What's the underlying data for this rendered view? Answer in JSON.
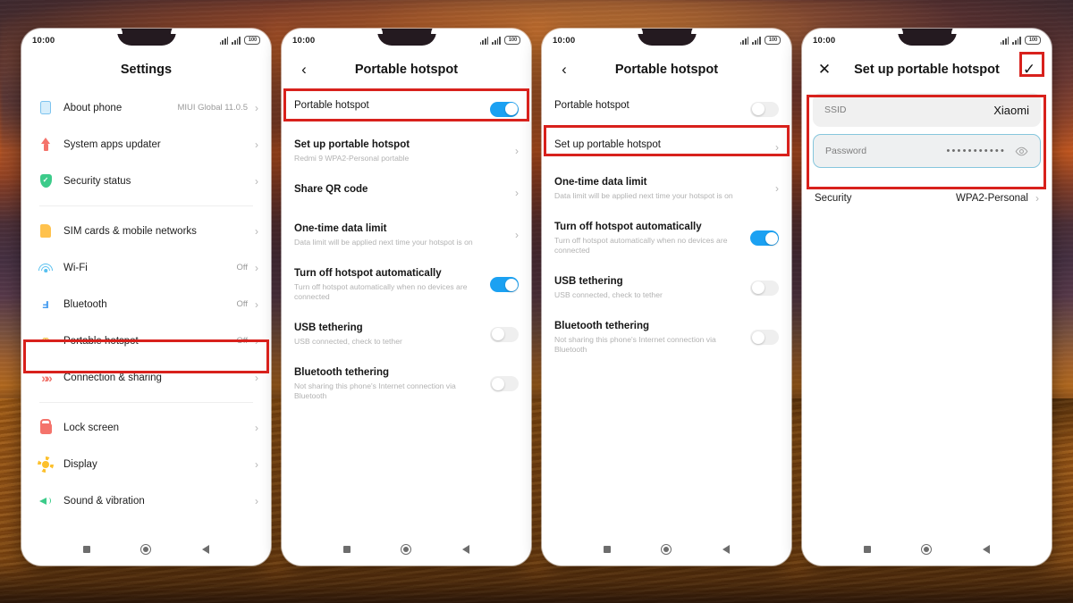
{
  "status_bar": {
    "time": "10:00",
    "battery_text": "100",
    "signal_icon": "signal-bars-icon",
    "battery_icon": "battery-icon"
  },
  "panel1": {
    "title": "Settings",
    "items": [
      {
        "label": "About phone",
        "value": "MIUI Global 11.0.5",
        "icon": "phone-icon"
      },
      {
        "label": "System apps updater",
        "value": "",
        "icon": "up-arrow-icon"
      },
      {
        "label": "Security status",
        "value": "",
        "icon": "shield-check-icon"
      },
      {
        "label": "SIM cards & mobile networks",
        "value": "",
        "icon": "sim-card-icon"
      },
      {
        "label": "Wi-Fi",
        "value": "Off",
        "icon": "wifi-icon"
      },
      {
        "label": "Bluetooth",
        "value": "Off",
        "icon": "bluetooth-icon"
      },
      {
        "label": "Portable hotspot",
        "value": "Off",
        "icon": "hotspot-icon"
      },
      {
        "label": "Connection & sharing",
        "value": "",
        "icon": "connection-sharing-icon"
      },
      {
        "label": "Lock screen",
        "value": "",
        "icon": "lock-icon"
      },
      {
        "label": "Display",
        "value": "",
        "icon": "brightness-sun-icon"
      },
      {
        "label": "Sound & vibration",
        "value": "",
        "icon": "volume-icon"
      }
    ]
  },
  "panel2": {
    "title": "Portable hotspot",
    "back_icon": "back-chevron-icon",
    "rows": [
      {
        "title": "Portable hotspot",
        "subtitle": "",
        "control": "toggle",
        "state": "on"
      },
      {
        "title": "Set up portable hotspot",
        "subtitle": "Redmi 9 WPA2-Personal portable",
        "control": "chevron",
        "state": ""
      },
      {
        "title": "Share QR code",
        "subtitle": "",
        "control": "chevron",
        "state": ""
      },
      {
        "title": "One-time data limit",
        "subtitle": "Data limit will be applied next time your hotspot is on",
        "control": "chevron",
        "state": ""
      },
      {
        "title": "Turn off hotspot automatically",
        "subtitle": "Turn off hotspot automatically when no devices are connected",
        "control": "toggle",
        "state": "on"
      },
      {
        "title": "USB tethering",
        "subtitle": "USB connected, check to tether",
        "control": "toggle",
        "state": "off"
      },
      {
        "title": "Bluetooth tethering",
        "subtitle": "Not sharing this phone's Internet connection via Bluetooth",
        "control": "toggle",
        "state": "off"
      }
    ]
  },
  "panel3": {
    "title": "Portable hotspot",
    "back_icon": "back-chevron-icon",
    "rows": [
      {
        "title": "Portable hotspot",
        "subtitle": "",
        "control": "toggle",
        "state": "off"
      },
      {
        "title": "Set up portable hotspot",
        "subtitle": "",
        "control": "chevron",
        "state": ""
      },
      {
        "title": "One-time data limit",
        "subtitle": "Data limit will be applied next time your hotspot is on",
        "control": "chevron",
        "state": ""
      },
      {
        "title": "Turn off hotspot automatically",
        "subtitle": "Turn off hotspot automatically when no devices are connected",
        "control": "toggle",
        "state": "on"
      },
      {
        "title": "USB tethering",
        "subtitle": "USB connected, check to tether",
        "control": "toggle",
        "state": "off"
      },
      {
        "title": "Bluetooth tethering",
        "subtitle": "Not sharing this phone's Internet connection via Bluetooth",
        "control": "toggle",
        "state": "off"
      }
    ]
  },
  "panel4": {
    "title": "Set up portable hotspot",
    "close_icon": "close-x-icon",
    "confirm_icon": "checkmark-icon",
    "ssid": {
      "label": "SSID",
      "value": "Xiaomi"
    },
    "password": {
      "label": "Password",
      "masked_value": "•••••••••••",
      "reveal_icon": "eye-icon"
    },
    "security": {
      "label": "Security",
      "value": "WPA2-Personal"
    }
  },
  "nav_bar": {
    "recents_icon": "square-recents-icon",
    "home_icon": "circle-home-icon",
    "back_icon": "triangle-back-icon"
  },
  "highlights": {
    "color": "#d8211c"
  }
}
